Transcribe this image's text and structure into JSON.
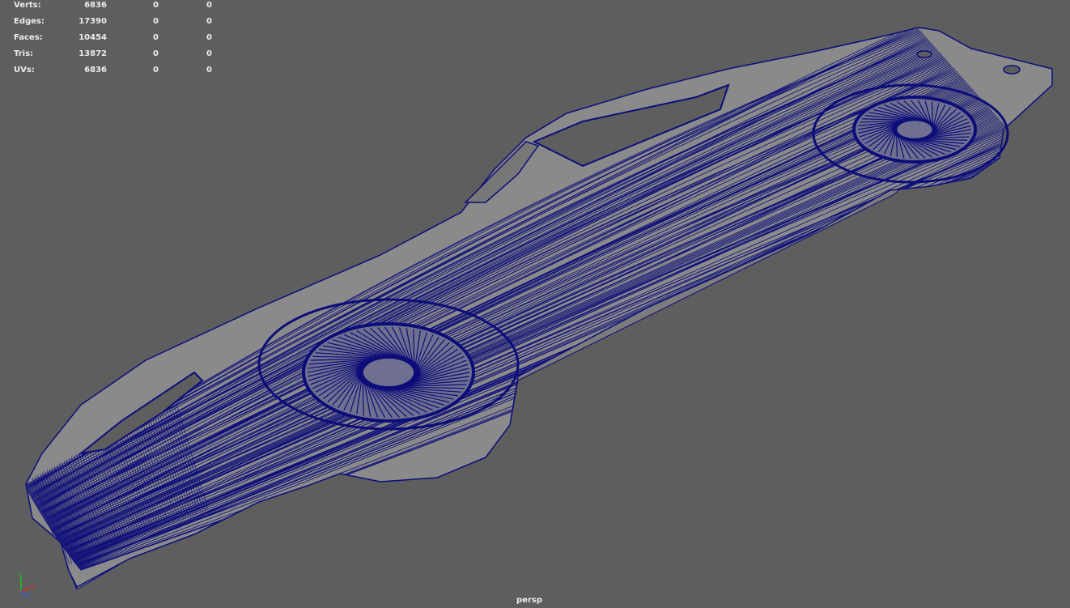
{
  "hud": {
    "rows": [
      {
        "label": "Verts:",
        "total": "6836",
        "selected": "0",
        "component": "0"
      },
      {
        "label": "Edges:",
        "total": "17390",
        "selected": "0",
        "component": "0"
      },
      {
        "label": "Faces:",
        "total": "10454",
        "selected": "0",
        "component": "0"
      },
      {
        "label": "Tris:",
        "total": "13872",
        "selected": "0",
        "component": "0"
      },
      {
        "label": "UVs:",
        "total": "6836",
        "selected": "0",
        "component": "0"
      }
    ]
  },
  "viewport": {
    "camera": "persp",
    "background_color": "#5e5e5e",
    "wireframe_color": "#0d0d7a",
    "surface_color": "#8a8a8a"
  },
  "axis_gizmo": {
    "x_label": "x",
    "y_label": "y",
    "z_label": "z",
    "x_color": "#e02020",
    "y_color": "#20c020",
    "z_color": "#3060ff"
  }
}
